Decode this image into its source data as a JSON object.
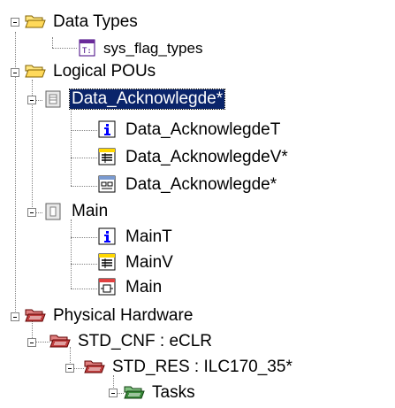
{
  "tree": {
    "data_types": {
      "label": "Data Types",
      "children": {
        "sys_flag_types": "sys_flag_types"
      }
    },
    "logical_pous": {
      "label": "Logical POUs",
      "data_acknowledge": {
        "label": "Data_Acknowlegde*",
        "children": {
          "type": "Data_AcknowlegdeT",
          "vars": "Data_AcknowlegdeV*",
          "code": "Data_Acknowlegde*"
        }
      },
      "main": {
        "label": "Main",
        "children": {
          "type": "MainT",
          "vars": "MainV",
          "code": "Main"
        }
      }
    },
    "physical_hardware": {
      "label": "Physical Hardware",
      "std_cnf": {
        "label": "STD_CNF : eCLR",
        "std_res": {
          "label": "STD_RES : ILC170_35*",
          "tasks": "Tasks"
        }
      }
    }
  },
  "colors": {
    "selection": "#0a246a",
    "folder_yellow": "#ffd95a",
    "folder_red": "#c04040",
    "folder_green": "#3a8a3a",
    "info_blue": "#0000ff"
  }
}
